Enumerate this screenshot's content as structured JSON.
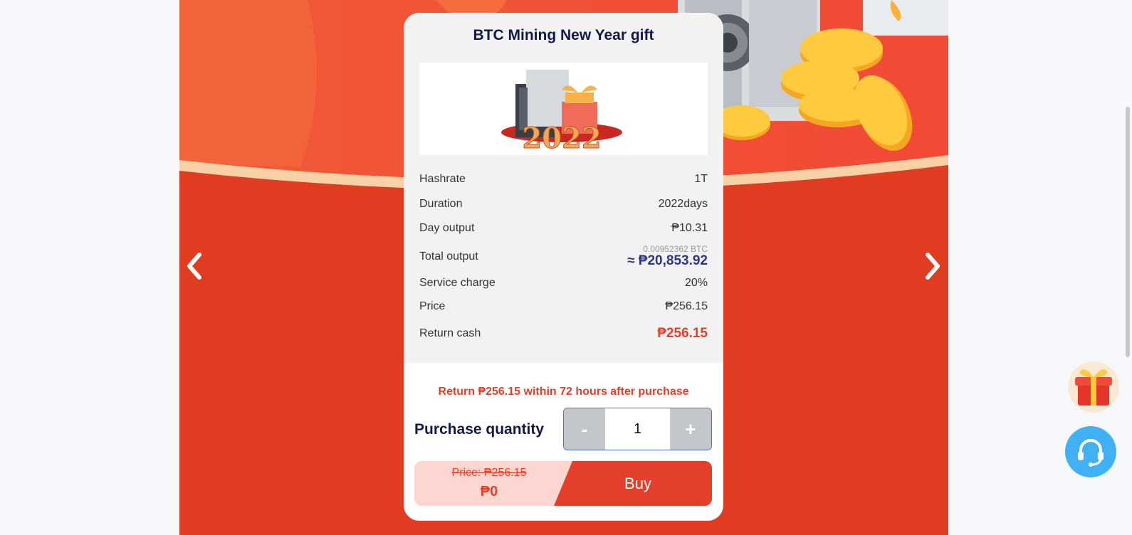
{
  "card": {
    "title": "BTC Mining New Year gift",
    "image_alt": "2022"
  },
  "specs": {
    "hashrate_label": "Hashrate",
    "hashrate_value": "1T",
    "duration_label": "Duration",
    "duration_value": "2022days",
    "day_output_label": "Day output",
    "day_output_value": "₱10.31",
    "total_output_label": "Total output",
    "total_output_btc": "0.00952362 BTC",
    "total_output_value": "≈ ₱20,853.92",
    "service_charge_label": "Service charge",
    "service_charge_value": "20%",
    "price_label": "Price",
    "price_value": "₱256.15",
    "return_cash_label": "Return cash",
    "return_cash_value": "₱256.15"
  },
  "return_note": "Return ₱256.15 within 72 hours after purchase",
  "purchase": {
    "quantity_label": "Purchase quantity",
    "decrement": "-",
    "increment": "+",
    "quantity": "1"
  },
  "buy_bar": {
    "old_price": "Price: ₱256.15",
    "new_price": "₱0",
    "buy_label": "Buy"
  },
  "icons": {
    "prev": "chevron-left-icon",
    "next": "chevron-right-icon",
    "gift": "gift-icon",
    "support": "headset-icon"
  },
  "colors": {
    "banner_red": "#df3c22",
    "accent_red": "#e2402a",
    "navy": "#13184a",
    "support_blue": "#41b1f5"
  }
}
